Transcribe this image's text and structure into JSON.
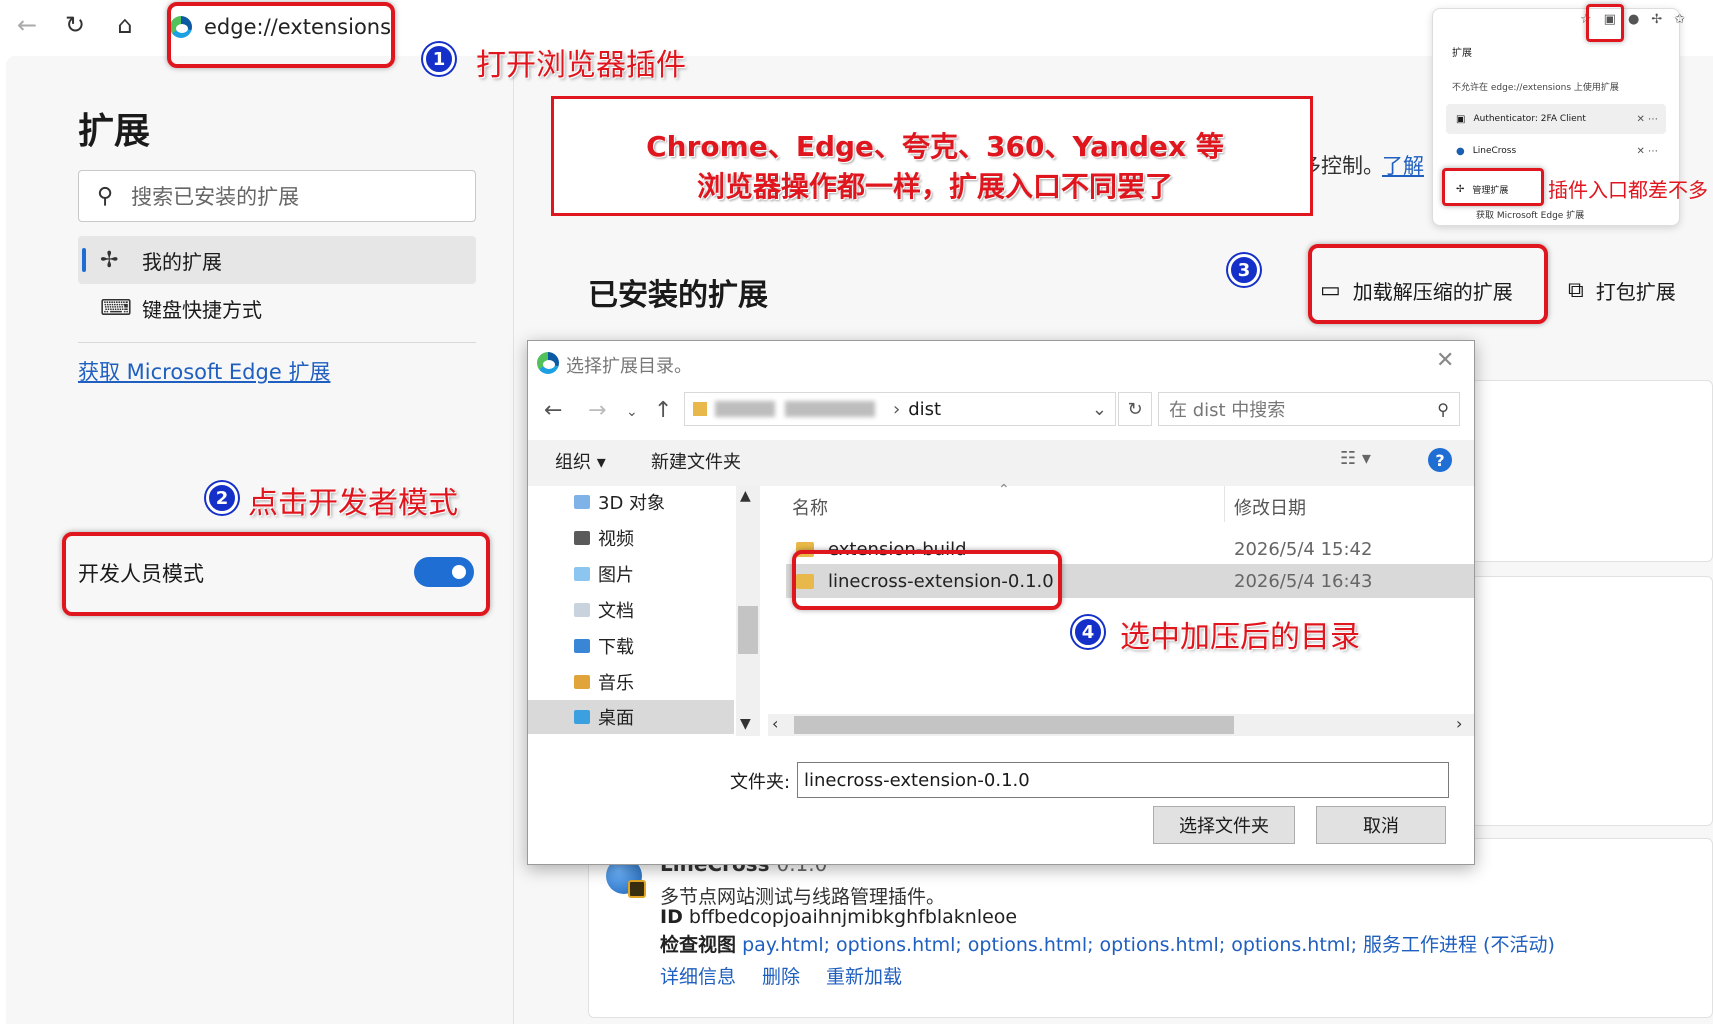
{
  "browser": {
    "address": "edge://extensions",
    "icons": {
      "back": "back-arrow-icon",
      "refresh": "refresh-icon",
      "home": "home-icon"
    }
  },
  "sidebar": {
    "title": "扩展",
    "search_placeholder": "搜索已安装的扩展",
    "items": [
      {
        "label": "我的扩展",
        "icon": "puzzle-icon"
      },
      {
        "label": "键盘快捷方式",
        "icon": "keyboard-icon"
      }
    ],
    "store_link": "获取 Microsoft Edge 扩展",
    "dev_mode_label": "开发人员模式",
    "dev_mode_on": true
  },
  "main": {
    "partial_text": "多控制。",
    "partial_link": "了解",
    "installed_title": "已安装的扩展",
    "load_unpacked": "加载解压缩的扩展",
    "pack": "打包扩展",
    "extension": {
      "name": "LineCross",
      "version": "0.1.0",
      "description": "多节点网站测试与线路管理插件。",
      "id_label": "ID",
      "id": "bffbedcopjoaihnjmibkghfblaknleoe",
      "views_label": "检查视图",
      "views": "pay.html; options.html; options.html; options.html; options.html; 服务工作进程 (不活动)",
      "actions": [
        "详细信息",
        "删除",
        "重新加载"
      ]
    }
  },
  "popup": {
    "title": "扩展",
    "subtitle": "不允许在 edge://extensions 上使用扩展",
    "items": [
      "Authenticator: 2FA Client",
      "LineCross"
    ],
    "manage": "管理扩展",
    "store": "获取 Microsoft Edge 扩展"
  },
  "dialog": {
    "title": "选择扩展目录。",
    "path_current": "dist",
    "search_placeholder": "在 dist 中搜索",
    "organize": "组织 ▾",
    "new_folder": "新建文件夹",
    "tree": [
      "3D 对象",
      "视频",
      "图片",
      "文档",
      "下载",
      "音乐",
      "桌面"
    ],
    "col_name": "名称",
    "col_date": "修改日期",
    "files": [
      {
        "name": "extension-build",
        "date": "2026/5/4 15:42"
      },
      {
        "name": "linecross-extension-0.1.0",
        "date": "2026/5/4 16:43"
      }
    ],
    "folder_label": "文件夹:",
    "folder_value": "linecross-extension-0.1.0",
    "select_button": "选择文件夹",
    "cancel_button": "取消"
  },
  "annotations": {
    "n1": "1",
    "a1": "打开浏览器插件",
    "n2": "2",
    "a2": "点击开发者模式",
    "n3": "3",
    "n4": "4",
    "a4": "选中加压后的目录",
    "banner_line1": "Chrome、Edge、夸克、360、Yandex 等",
    "banner_line2": "浏览器操作都一样，扩展入口不同罢了",
    "popup_note": "插件入口都差不多"
  },
  "colors": {
    "accent": "#1f6ed4",
    "annotation_red": "#e0161e",
    "badge_blue": "#1530c8"
  }
}
